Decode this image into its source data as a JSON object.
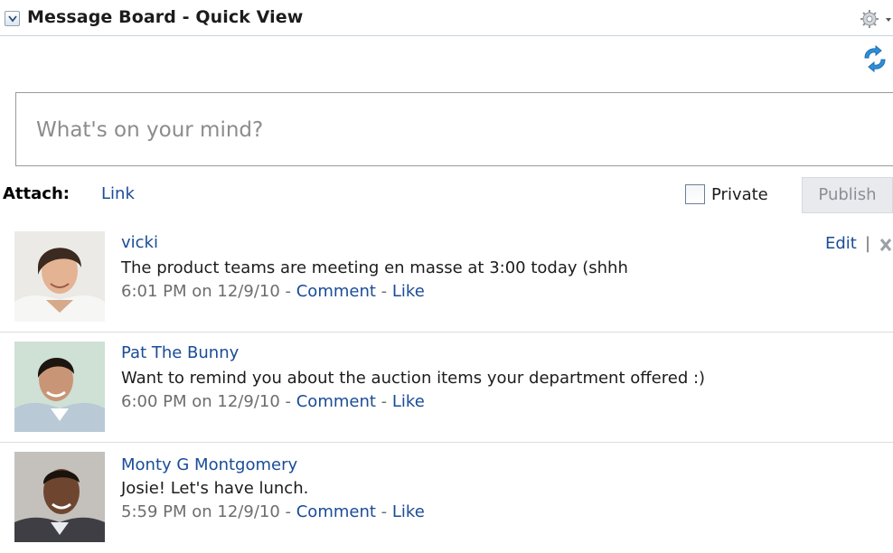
{
  "header": {
    "title": "Message Board - Quick View",
    "collapse_icon": "chevron-down-icon",
    "settings_icon": "gear-icon"
  },
  "toolbar": {
    "refresh_icon": "refresh-icon"
  },
  "composer": {
    "placeholder": "What's on your mind?"
  },
  "attach": {
    "label": "Attach:",
    "link_label": "Link",
    "private_label": "Private",
    "private_checked": false,
    "publish_label": "Publish"
  },
  "posts": [
    {
      "author": "vicki",
      "message": "The product teams are meeting en masse at 3:00 today (shhh",
      "time": "6:01 PM on 12/9/10",
      "sep1": " - ",
      "comment_label": "Comment",
      "sep2": " - ",
      "like_label": "Like",
      "edit_label": "Edit",
      "pipe": "|"
    },
    {
      "author": "Pat The Bunny",
      "message": "Want to remind you about the auction items your department offered :)",
      "time": "6:00 PM on 12/9/10",
      "sep1": " - ",
      "comment_label": "Comment",
      "sep2": " - ",
      "like_label": "Like"
    },
    {
      "author": "Monty G Montgomery",
      "message": "Josie! Let's have lunch.",
      "time": "5:59 PM on 12/9/10",
      "sep1": " - ",
      "comment_label": "Comment",
      "sep2": " - ",
      "like_label": "Like"
    }
  ],
  "colors": {
    "link": "#1a4c97",
    "meta": "#6d6d6d",
    "divider": "#dcdcdc",
    "refresh": "#2f8fd6"
  }
}
